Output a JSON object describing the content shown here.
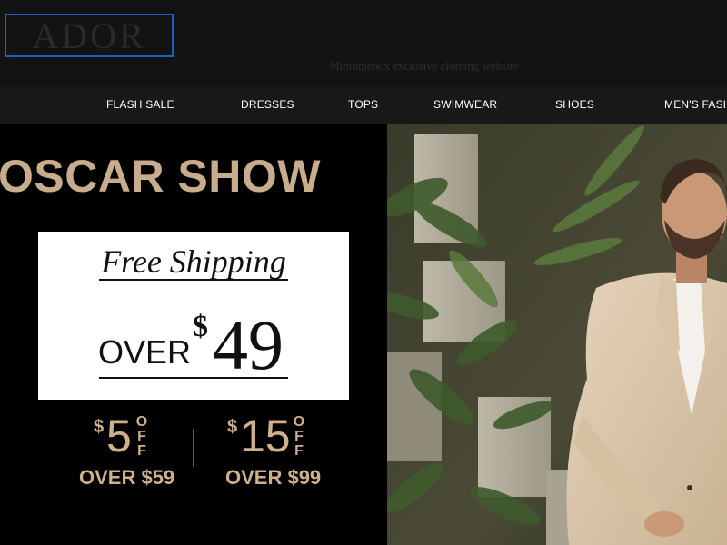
{
  "header": {
    "logo_text": "ADOR",
    "tagline": "Mininthebox exclusive clothing website"
  },
  "nav": {
    "items": [
      {
        "label": "FLASH SALE"
      },
      {
        "label": "DRESSES"
      },
      {
        "label": "TOPS"
      },
      {
        "label": "SWIMWEAR"
      },
      {
        "label": "SHOES"
      },
      {
        "label": "MEN'S FASH"
      }
    ]
  },
  "banner": {
    "headline": "OSCAR SHOW",
    "shipping": {
      "title": "Free Shipping",
      "over_label": "OVER",
      "currency": "$",
      "amount": "49"
    },
    "offers": [
      {
        "currency": "$",
        "amount": "5",
        "off_letters": [
          "O",
          "F",
          "F"
        ],
        "condition": "OVER $59"
      },
      {
        "currency": "$",
        "amount": "15",
        "off_letters": [
          "O",
          "F",
          "F"
        ],
        "condition": "OVER $99"
      }
    ]
  },
  "colors": {
    "background": "#131313",
    "nav_background": "#181818",
    "gold_text": "#c8ad8c",
    "logo_border": "#1f5fbf"
  }
}
